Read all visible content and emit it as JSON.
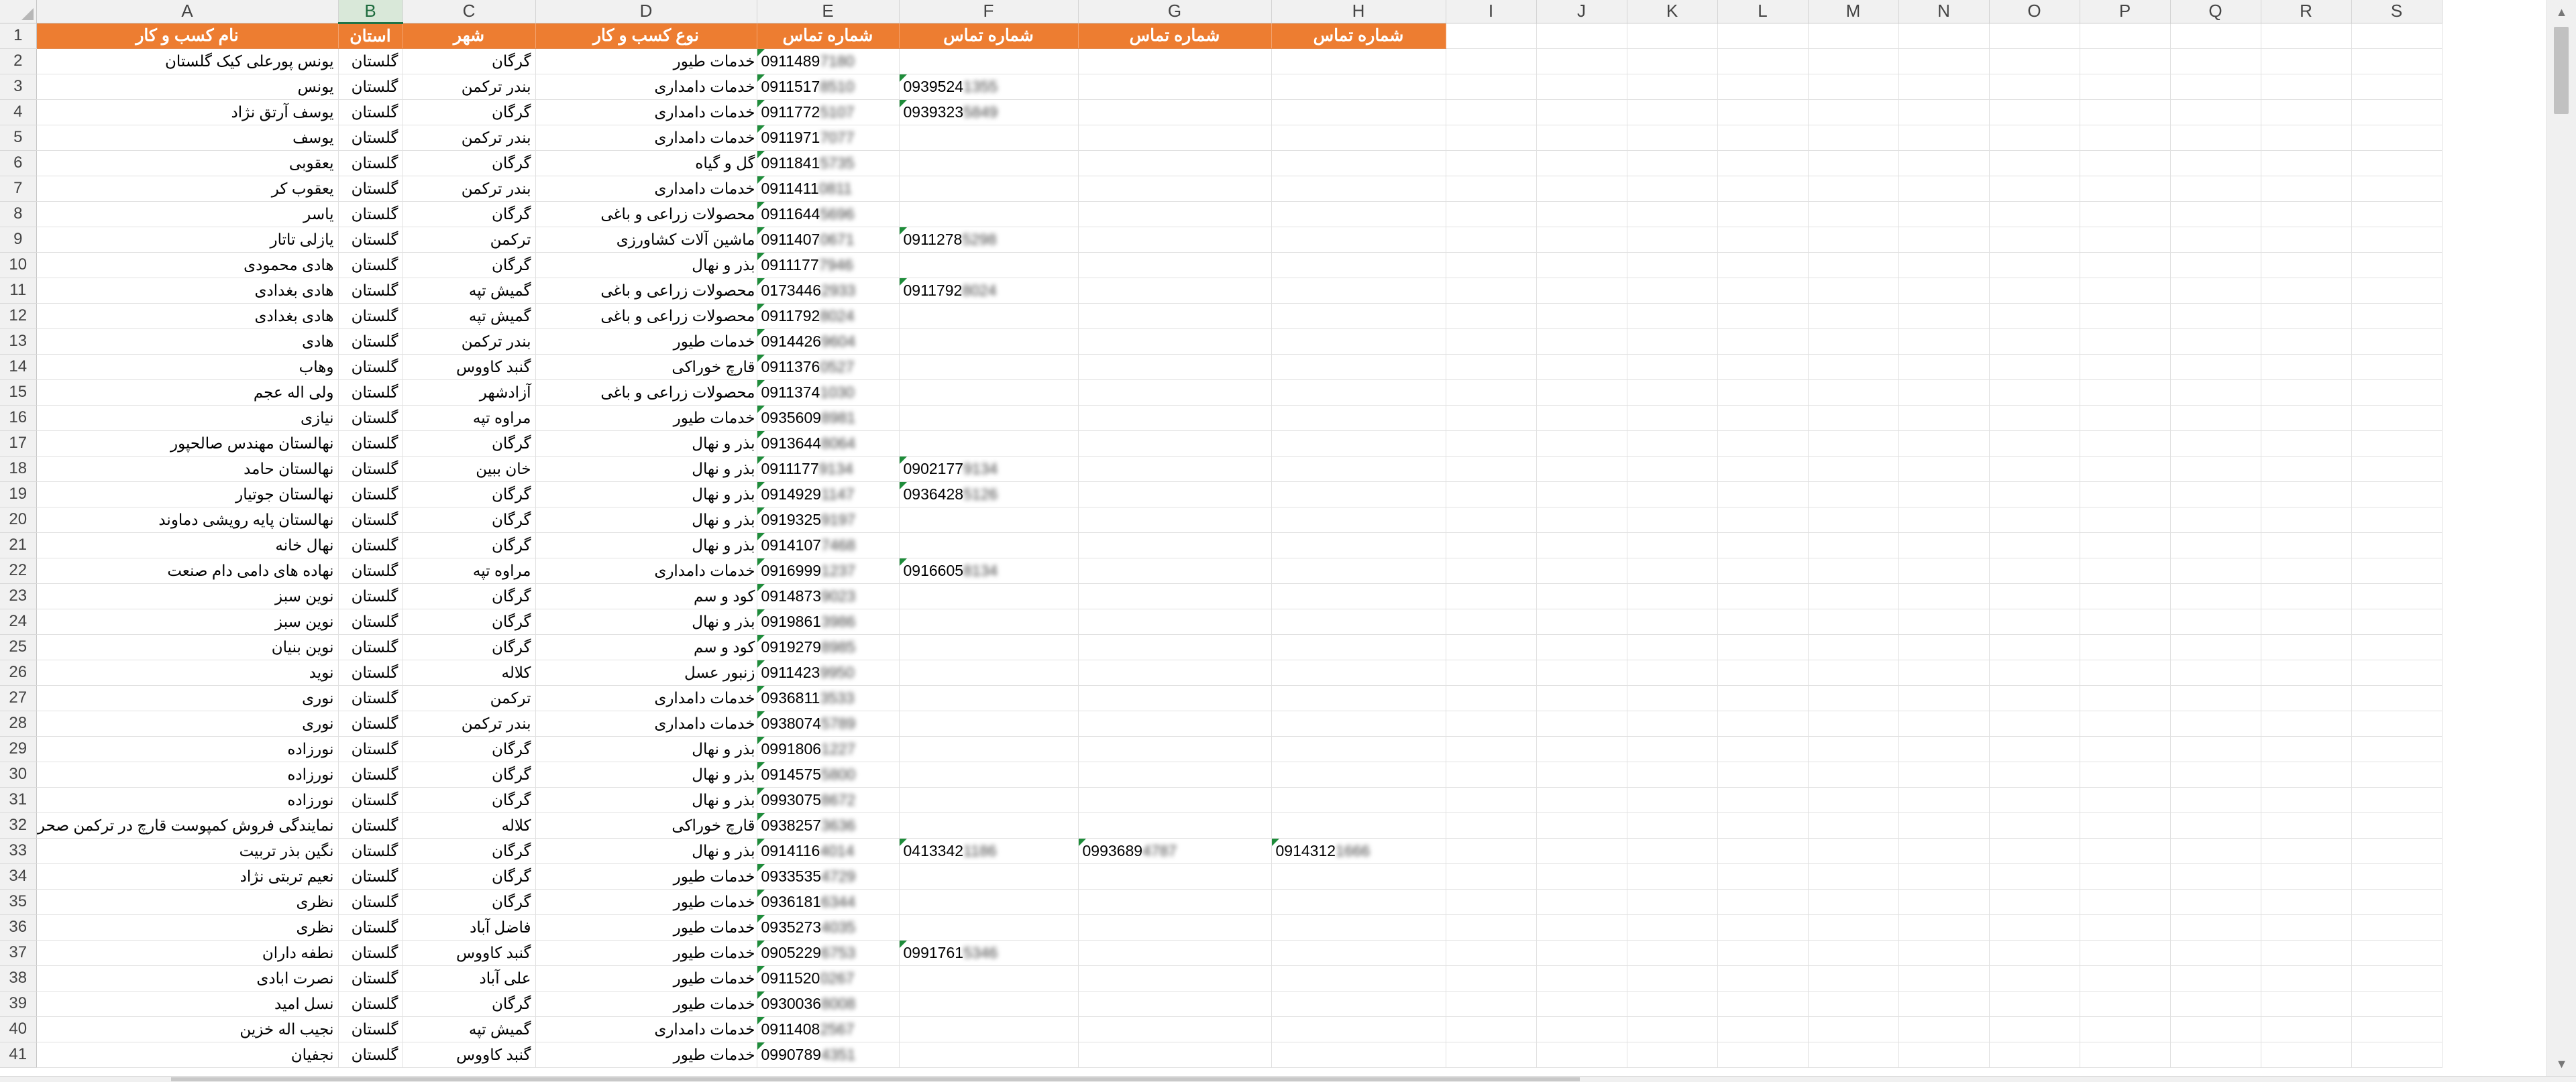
{
  "columns": [
    "A",
    "B",
    "C",
    "D",
    "E",
    "F",
    "G",
    "H",
    "I",
    "J",
    "K",
    "L",
    "M",
    "N",
    "O",
    "P",
    "Q",
    "R",
    "S"
  ],
  "selected_column": "B",
  "header_row": [
    "نام کسب و کار",
    "استان",
    "شهر",
    "نوع کسب و کار",
    "شماره تماس",
    "شماره تماس",
    "شماره تماس",
    "شماره تماس"
  ],
  "rows": [
    {
      "n": "2",
      "name": "یونس پورعلی کیک گلستان",
      "province": "گلستان",
      "city": "گرگان",
      "type": "خدمات طیور",
      "phone": "0911489",
      "phone_tail": "7180",
      "f": "",
      "f_tail": "",
      "g": "",
      "g_tail": "",
      "h": "",
      "h_tail": ""
    },
    {
      "n": "3",
      "name": "یونس",
      "province": "گلستان",
      "city": "بندر ترکمن",
      "type": "خدمات دامداری",
      "phone": "0911517",
      "phone_tail": "8510",
      "f": "0939524",
      "f_tail": "1355",
      "g": "",
      "g_tail": "",
      "h": "",
      "h_tail": ""
    },
    {
      "n": "4",
      "name": "یوسف آرتق نژاد",
      "province": "گلستان",
      "city": "گرگان",
      "type": "خدمات دامداری",
      "phone": "0911772",
      "phone_tail": "5107",
      "f": "0939323",
      "f_tail": "5849",
      "g": "",
      "g_tail": "",
      "h": "",
      "h_tail": ""
    },
    {
      "n": "5",
      "name": "یوسف",
      "province": "گلستان",
      "city": "بندر ترکمن",
      "type": "خدمات دامداری",
      "phone": "0911971",
      "phone_tail": "7077",
      "f": "",
      "f_tail": "",
      "g": "",
      "g_tail": "",
      "h": "",
      "h_tail": ""
    },
    {
      "n": "6",
      "name": "یعقوبی",
      "province": "گلستان",
      "city": "گرگان",
      "type": "گل و گیاه",
      "phone": "0911841",
      "phone_tail": "5735",
      "f": "",
      "f_tail": "",
      "g": "",
      "g_tail": "",
      "h": "",
      "h_tail": ""
    },
    {
      "n": "7",
      "name": "یعقوب کر",
      "province": "گلستان",
      "city": "بندر ترکمن",
      "type": "خدمات دامداری",
      "phone": "0911411",
      "phone_tail": "0811",
      "f": "",
      "f_tail": "",
      "g": "",
      "g_tail": "",
      "h": "",
      "h_tail": ""
    },
    {
      "n": "8",
      "name": "یاسر",
      "province": "گلستان",
      "city": "گرگان",
      "type": "محصولات زراعی و باغی",
      "phone": "0911644",
      "phone_tail": "5696",
      "f": "",
      "f_tail": "",
      "g": "",
      "g_tail": "",
      "h": "",
      "h_tail": ""
    },
    {
      "n": "9",
      "name": "یازلی تاتار",
      "province": "گلستان",
      "city": "ترکمن",
      "type": "ماشین آلات کشاورزی",
      "phone": "0911407",
      "phone_tail": "0671",
      "f": "0911278",
      "f_tail": "5298",
      "g": "",
      "g_tail": "",
      "h": "",
      "h_tail": ""
    },
    {
      "n": "10",
      "name": "هادی محمودی",
      "province": "گلستان",
      "city": "گرگان",
      "type": "بذر و نهال",
      "phone": "0911177",
      "phone_tail": "7946",
      "f": "",
      "f_tail": "",
      "g": "",
      "g_tail": "",
      "h": "",
      "h_tail": ""
    },
    {
      "n": "11",
      "name": "هادی بغدادی",
      "province": "گلستان",
      "city": "گمیش تپه",
      "type": "محصولات زراعی و باغی",
      "phone": "0173446",
      "phone_tail": "2933",
      "f": "0911792",
      "f_tail": "8024",
      "g": "",
      "g_tail": "",
      "h": "",
      "h_tail": ""
    },
    {
      "n": "12",
      "name": "هادی بغدادی",
      "province": "گلستان",
      "city": "گمیش تپه",
      "type": "محصولات زراعی و باغی",
      "phone": "0911792",
      "phone_tail": "8024",
      "f": "",
      "f_tail": "",
      "g": "",
      "g_tail": "",
      "h": "",
      "h_tail": ""
    },
    {
      "n": "13",
      "name": "هادی",
      "province": "گلستان",
      "city": "بندر ترکمن",
      "type": "خدمات طیور",
      "phone": "0914426",
      "phone_tail": "9604",
      "f": "",
      "f_tail": "",
      "g": "",
      "g_tail": "",
      "h": "",
      "h_tail": ""
    },
    {
      "n": "14",
      "name": "وهاب",
      "province": "گلستان",
      "city": "گنبد کاووس",
      "type": "قارچ خوراکی",
      "phone": "0911376",
      "phone_tail": "0527",
      "f": "",
      "f_tail": "",
      "g": "",
      "g_tail": "",
      "h": "",
      "h_tail": ""
    },
    {
      "n": "15",
      "name": "ولی اله عجم",
      "province": "گلستان",
      "city": "آزادشهر",
      "type": "محصولات زراعی و باغی",
      "phone": "0911374",
      "phone_tail": "1030",
      "f": "",
      "f_tail": "",
      "g": "",
      "g_tail": "",
      "h": "",
      "h_tail": ""
    },
    {
      "n": "16",
      "name": "نیازی",
      "province": "گلستان",
      "city": "مراوه تپه",
      "type": "خدمات طیور",
      "phone": "0935609",
      "phone_tail": "8981",
      "f": "",
      "f_tail": "",
      "g": "",
      "g_tail": "",
      "h": "",
      "h_tail": ""
    },
    {
      "n": "17",
      "name": "نهالستان مهندس صالحپور",
      "province": "گلستان",
      "city": "گرگان",
      "type": "بذر و نهال",
      "phone": "0913644",
      "phone_tail": "8064",
      "f": "",
      "f_tail": "",
      "g": "",
      "g_tail": "",
      "h": "",
      "h_tail": ""
    },
    {
      "n": "18",
      "name": "نهالستان حامد",
      "province": "گلستان",
      "city": "خان ببین",
      "type": "بذر و نهال",
      "phone": "0911177",
      "phone_tail": "9134",
      "f": "0902177",
      "f_tail": "9134",
      "g": "",
      "g_tail": "",
      "h": "",
      "h_tail": ""
    },
    {
      "n": "19",
      "name": "نهالستان جوتیار",
      "province": "گلستان",
      "city": "گرگان",
      "type": "بذر و نهال",
      "phone": "0914929",
      "phone_tail": "1147",
      "f": "0936428",
      "f_tail": "5126",
      "g": "",
      "g_tail": "",
      "h": "",
      "h_tail": ""
    },
    {
      "n": "20",
      "name": "نهالستان پایه رویشی دماوند",
      "province": "گلستان",
      "city": "گرگان",
      "type": "بذر و نهال",
      "phone": "0919325",
      "phone_tail": "9197",
      "f": "",
      "f_tail": "",
      "g": "",
      "g_tail": "",
      "h": "",
      "h_tail": ""
    },
    {
      "n": "21",
      "name": "نهال خانه",
      "province": "گلستان",
      "city": "گرگان",
      "type": "بذر و نهال",
      "phone": "0914107",
      "phone_tail": "7468",
      "f": "",
      "f_tail": "",
      "g": "",
      "g_tail": "",
      "h": "",
      "h_tail": ""
    },
    {
      "n": "22",
      "name": "نهاده های دامی دام صنعت",
      "province": "گلستان",
      "city": "مراوه تپه",
      "type": "خدمات دامداری",
      "phone": "0916999",
      "phone_tail": "1237",
      "f": "0916605",
      "f_tail": "8134",
      "g": "",
      "g_tail": "",
      "h": "",
      "h_tail": ""
    },
    {
      "n": "23",
      "name": "نوین سبز",
      "province": "گلستان",
      "city": "گرگان",
      "type": "کود و سم",
      "phone": "0914873",
      "phone_tail": "9023",
      "f": "",
      "f_tail": "",
      "g": "",
      "g_tail": "",
      "h": "",
      "h_tail": ""
    },
    {
      "n": "24",
      "name": "نوین سبز",
      "province": "گلستان",
      "city": "گرگان",
      "type": "بذر و نهال",
      "phone": "0919861",
      "phone_tail": "3986",
      "f": "",
      "f_tail": "",
      "g": "",
      "g_tail": "",
      "h": "",
      "h_tail": ""
    },
    {
      "n": "25",
      "name": "نوین بنیان",
      "province": "گلستان",
      "city": "گرگان",
      "type": "کود و سم",
      "phone": "0919279",
      "phone_tail": "8985",
      "f": "",
      "f_tail": "",
      "g": "",
      "g_tail": "",
      "h": "",
      "h_tail": ""
    },
    {
      "n": "26",
      "name": "نوید",
      "province": "گلستان",
      "city": "کلاله",
      "type": "زنبور عسل",
      "phone": "0911423",
      "phone_tail": "9950",
      "f": "",
      "f_tail": "",
      "g": "",
      "g_tail": "",
      "h": "",
      "h_tail": ""
    },
    {
      "n": "27",
      "name": "نوری",
      "province": "گلستان",
      "city": "ترکمن",
      "type": "خدمات دامداری",
      "phone": "0936811",
      "phone_tail": "3533",
      "f": "",
      "f_tail": "",
      "g": "",
      "g_tail": "",
      "h": "",
      "h_tail": ""
    },
    {
      "n": "28",
      "name": "نوری",
      "province": "گلستان",
      "city": "بندر ترکمن",
      "type": "خدمات دامداری",
      "phone": "0938074",
      "phone_tail": "5789",
      "f": "",
      "f_tail": "",
      "g": "",
      "g_tail": "",
      "h": "",
      "h_tail": ""
    },
    {
      "n": "29",
      "name": "نورزاده",
      "province": "گلستان",
      "city": "گرگان",
      "type": "بذر و نهال",
      "phone": "0991806",
      "phone_tail": "1227",
      "f": "",
      "f_tail": "",
      "g": "",
      "g_tail": "",
      "h": "",
      "h_tail": ""
    },
    {
      "n": "30",
      "name": "نورزاده",
      "province": "گلستان",
      "city": "گرگان",
      "type": "بذر و نهال",
      "phone": "0914575",
      "phone_tail": "5800",
      "f": "",
      "f_tail": "",
      "g": "",
      "g_tail": "",
      "h": "",
      "h_tail": ""
    },
    {
      "n": "31",
      "name": "نورزاده",
      "province": "گلستان",
      "city": "گرگان",
      "type": "بذر و نهال",
      "phone": "0993075",
      "phone_tail": "8672",
      "f": "",
      "f_tail": "",
      "g": "",
      "g_tail": "",
      "h": "",
      "h_tail": ""
    },
    {
      "n": "32",
      "name": "نمایندگی فروش کمپوست قارچ در ترکمن صحرا",
      "province": "گلستان",
      "city": "کلاله",
      "type": "قارچ خوراکی",
      "phone": "0938257",
      "phone_tail": "3636",
      "f": "",
      "f_tail": "",
      "g": "",
      "g_tail": "",
      "h": "",
      "h_tail": ""
    },
    {
      "n": "33",
      "name": "نگین بذر تربیت",
      "province": "گلستان",
      "city": "گرگان",
      "type": "بذر و نهال",
      "phone": "0914116",
      "phone_tail": "4014",
      "f": "0413342",
      "f_tail": "1186",
      "g": "0993689",
      "g_tail": "4787",
      "h": "0914312",
      "h_tail": "1666"
    },
    {
      "n": "34",
      "name": "نعیم تربتی نژاد",
      "province": "گلستان",
      "city": "گرگان",
      "type": "خدمات طیور",
      "phone": "0933535",
      "phone_tail": "4729",
      "f": "",
      "f_tail": "",
      "g": "",
      "g_tail": "",
      "h": "",
      "h_tail": ""
    },
    {
      "n": "35",
      "name": "نظری",
      "province": "گلستان",
      "city": "گرگان",
      "type": "خدمات طیور",
      "phone": "0936181",
      "phone_tail": "6344",
      "f": "",
      "f_tail": "",
      "g": "",
      "g_tail": "",
      "h": "",
      "h_tail": ""
    },
    {
      "n": "36",
      "name": "نظری",
      "province": "گلستان",
      "city": "فاضل آباد",
      "type": "خدمات طیور",
      "phone": "0935273",
      "phone_tail": "4035",
      "f": "",
      "f_tail": "",
      "g": "",
      "g_tail": "",
      "h": "",
      "h_tail": ""
    },
    {
      "n": "37",
      "name": "نطفه داران",
      "province": "گلستان",
      "city": "گنبد کاووس",
      "type": "خدمات طیور",
      "phone": "0905229",
      "phone_tail": "6753",
      "f": "0991761",
      "f_tail": "5346",
      "g": "",
      "g_tail": "",
      "h": "",
      "h_tail": ""
    },
    {
      "n": "38",
      "name": "نصرت ابادی",
      "province": "گلستان",
      "city": "علی آباد",
      "type": "خدمات طیور",
      "phone": "0911520",
      "phone_tail": "0267",
      "f": "",
      "f_tail": "",
      "g": "",
      "g_tail": "",
      "h": "",
      "h_tail": ""
    },
    {
      "n": "39",
      "name": "نسل امید",
      "province": "گلستان",
      "city": "گرگان",
      "type": "خدمات طیور",
      "phone": "0930036",
      "phone_tail": "8008",
      "f": "",
      "f_tail": "",
      "g": "",
      "g_tail": "",
      "h": "",
      "h_tail": ""
    },
    {
      "n": "40",
      "name": "نجیب اله خزین",
      "province": "گلستان",
      "city": "گمیش تپه",
      "type": "خدمات دامداری",
      "phone": "0911408",
      "phone_tail": "2567",
      "f": "",
      "f_tail": "",
      "g": "",
      "g_tail": "",
      "h": "",
      "h_tail": ""
    },
    {
      "n": "41",
      "name": "نجفیان",
      "province": "گلستان",
      "city": "گنبد کاووس",
      "type": "خدمات طیور",
      "phone": "0990789",
      "phone_tail": "4351",
      "f": "",
      "f_tail": "",
      "g": "",
      "g_tail": "",
      "h": "",
      "h_tail": ""
    }
  ],
  "colors": {
    "header_fill": "#ed7d31",
    "header_text": "#ffffff",
    "selected_col_header": "#d9e8d9",
    "error_indicator": "#1e8c3a"
  },
  "icons": {
    "scroll_up": "triangle-up-icon",
    "scroll_down": "triangle-down-icon"
  }
}
